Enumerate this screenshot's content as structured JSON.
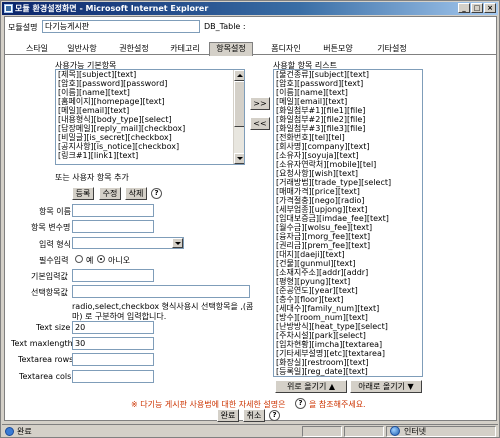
{
  "window": {
    "title": "모듈 환경설정화면 - Microsoft Internet Explorer",
    "buttons": [
      "_",
      "□",
      "×"
    ]
  },
  "header": {
    "module_label": "모듈설명",
    "module_value": "다기능게시판",
    "db_table_label": "DB_Table :"
  },
  "tabs": [
    {
      "label": "스타일",
      "active": false
    },
    {
      "label": "일반사항",
      "active": false
    },
    {
      "label": "권한설정",
      "active": false
    },
    {
      "label": "카테고리",
      "active": false
    },
    {
      "label": "항목설정",
      "active": true
    },
    {
      "label": "폼디자인",
      "active": false
    },
    {
      "label": "버튼모양",
      "active": false
    },
    {
      "label": "기타설정",
      "active": false
    }
  ],
  "available": {
    "title": "사용가능 기본항목",
    "items": [
      "[제목][subject][text]",
      "[암호][password][password]",
      "[이름][name][text]",
      "[홈페이지][homepage][text]",
      "[메일][email][text]",
      "[내용형식][body_type][select]",
      "[답장메일][reply_mail][checkbox]",
      "[비밀글][is_secret][checkbox]",
      "[공지사항][is_notice][checkbox]",
      "[링크#1][link1][text]"
    ]
  },
  "move_buttons": {
    "add": ">>",
    "remove": "<<"
  },
  "custom": {
    "title": "또는 사용자 항목 추가",
    "register": "등록",
    "modify": "수정",
    "delete": "삭제",
    "help": "?"
  },
  "form": {
    "item_name_label": "항목 이름",
    "item_var_label": "항목 변수명",
    "input_type_label": "입력 형식",
    "required_label": "필수입력",
    "required_yes": "예",
    "required_no": "아니오",
    "default_label": "기본입력값",
    "options_label": "선택항목값",
    "options_note_line1": "radio,select,checkbox 형식사용시 선택항목을 ,(콤",
    "options_note_line2": "마) 로 구분하여 입력합니다.",
    "text_size_label": "Text size",
    "text_size_value": "20",
    "text_maxlength_label": "Text maxlength",
    "text_maxlength_value": "30",
    "textarea_rows_label": "Textarea rows",
    "textarea_rows_value": "",
    "textarea_cols_label": "Textarea cols",
    "textarea_cols_value": ""
  },
  "used": {
    "title": "사용할 항목 리스트",
    "items": [
      "[물건종류][subject][text]",
      "[암호][password][text]",
      "[이름][name][text]",
      "[메일][email][text]",
      "[화일첨부#1][file1][file]",
      "[화일첨부#2][file2][file]",
      "[화일첨부#3][file3][file]",
      "[전화번호][tel][tel]",
      "[회사명][company][text]",
      "[소유자][soyuja][text]",
      "[소유자연락처][mobile][tel]",
      "[요청사항][wish][text]",
      "[거래방법][trade_type][select]",
      "[매매가격][price][text]",
      "[가격절충][nego][radio]",
      "[세부업종][upjong][text]",
      "[임대보증금][imdae_fee][text]",
      "[월수금][wolsu_fee][text]",
      "[융자금][morg_fee][text]",
      "[권리금][prem_fee][text]",
      "[대지][daeji][text]",
      "[건물][gunmul][text]",
      "[소재지주소][addr][addr]",
      "[평형][pyung][text]",
      "[준공연도][year][text]",
      "[층수][floor][text]",
      "[세대수][family_num][text]",
      "[방수][room_num][text]",
      "[난방방식][heat_type][select]",
      "[주차시설][park][select]",
      "[임차현황][imcha][textarea]",
      "[기타세부설명][etc][textarea]",
      "[화장실][restroom][text]",
      "[등록일][reg_date][text]"
    ],
    "move_up": "위로 올기기 ▲",
    "move_down": "아래로 올기기 ▼"
  },
  "footer": {
    "note_prefix": "※ 다기능 게시판 사용법에 대한 자세한 설명은",
    "note_suffix": "을 참조해주세요.",
    "ok": "완료",
    "cancel": "취소",
    "help": "?"
  },
  "status": {
    "left": "완료",
    "zone": "인터넷"
  }
}
